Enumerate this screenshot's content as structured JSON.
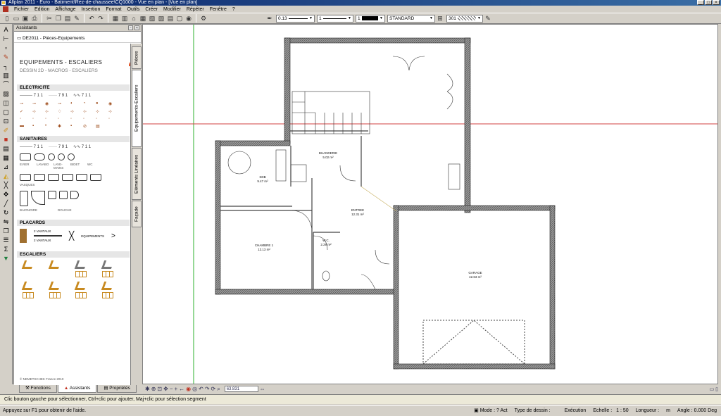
{
  "window": {
    "title": "Allplan 2011 - Euro - Batiment\\Rez-de-chaussee\\CQ1000 - Vue en plan - [Vue en plan]"
  },
  "menu": [
    "Fichier",
    "Edition",
    "Affichage",
    "Insertion",
    "Format",
    "Outils",
    "Créer",
    "Modifier",
    "Répéter",
    "Fenêtre",
    "?"
  ],
  "toolbar": {
    "pen_thickness": "0.13",
    "line_type": "1",
    "color_index": "1",
    "layer": "STANDARD",
    "hatch": "301"
  },
  "assistants": {
    "title": "Assistants",
    "library": "DE2011 - Pièces-Equipements",
    "heading": "EQUIPEMENTS - ESCALIERS",
    "subheading": "DESSIN 2D - MACROS - ESCALIERS",
    "sections": [
      "ELECTRICITE",
      "SANITAIRES",
      "PLACARDS",
      "ESCALIERS"
    ],
    "line_labels": [
      "7 1 1",
      "7 9 1",
      "7 1 1"
    ],
    "sanit_labels": [
      "EVIER",
      "LAVABO",
      "LAVE-MAINS",
      "BIDET",
      "WC"
    ],
    "sanit_labels2": [
      "VASQUES"
    ],
    "sanit_labels3": [
      "BAIGNOIRE",
      "DOUCHE"
    ],
    "placard_labels": [
      "2 VANTAUX",
      "2 VANTAUX",
      "EQUIPEMENTS"
    ],
    "copyright": "© NEMETSCHEK France 2010",
    "vertical_tabs": [
      "Pièces",
      "Equipements-Escaliers",
      "Eléments Linéaires",
      "Façade"
    ]
  },
  "panel_tabs": [
    "Fonctions",
    "Assistants",
    "Propriétés"
  ],
  "rooms": [
    {
      "name": "SDB",
      "area": "9.47 m²"
    },
    {
      "name": "BUANDERIE",
      "area": "5.02 m²"
    },
    {
      "name": "ENTREE",
      "area": "12.31 m²"
    },
    {
      "name": "CHAMBRE 1",
      "area": "13.13 m²"
    },
    {
      "name": "W.C.",
      "area": "2.29 m²"
    },
    {
      "name": "GARAGE",
      "area": "42.63 m²"
    }
  ],
  "zoom_value": "63.831",
  "hint": "Clic bouton gauche pour sélectionner, Ctrl+clic pour ajouter, Maj+clic pour sélection segment",
  "status": {
    "help": "Appuyez sur F1 pour obtenir de l'aide.",
    "mode_label": "Mode :",
    "mode_value": "? Act",
    "drawing_type_label": "Type de dessin :",
    "drawing_type_value": "Exécution",
    "scale_label": "Echelle :",
    "scale_value": "1 : 50",
    "length_label": "Longueur :",
    "length_unit": "m",
    "angle_label": "Angle :",
    "angle_value": "0.000",
    "angle_unit": "Deg"
  }
}
